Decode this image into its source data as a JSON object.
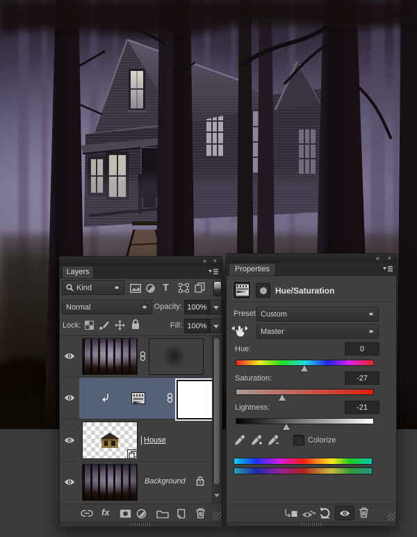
{
  "icons": {
    "collapse": "«",
    "close": "×",
    "type_filter": "T",
    "fx": "fx"
  },
  "layers_panel": {
    "tab": "Layers",
    "filter_kind": "Kind",
    "blend_mode": "Normal",
    "opacity_label": "Opacity:",
    "opacity_value": "100%",
    "lock_label": "Lock:",
    "fill_label": "Fill:",
    "fill_value": "100%",
    "rows": {
      "house_label": "House",
      "background_label": "Background"
    }
  },
  "properties_panel": {
    "tab": "Properties",
    "title": "Hue/Saturation",
    "preset_label": "Preset:",
    "preset_value": "Custom",
    "channel_value": "Master",
    "hue_label": "Hue:",
    "hue_value": "0",
    "saturation_label": "Saturation:",
    "saturation_value": "-27",
    "lightness_label": "Lightness:",
    "lightness_value": "-21",
    "colorize_label": "Colorize"
  },
  "colors": {
    "panel_bg": "#3f3f3f",
    "panel_chrome": "#282828",
    "selected_layer_row": "#566078",
    "workspace_bg": "#3a3a3a",
    "fog": "#6f6884",
    "saturation_red": "#e0200e"
  }
}
